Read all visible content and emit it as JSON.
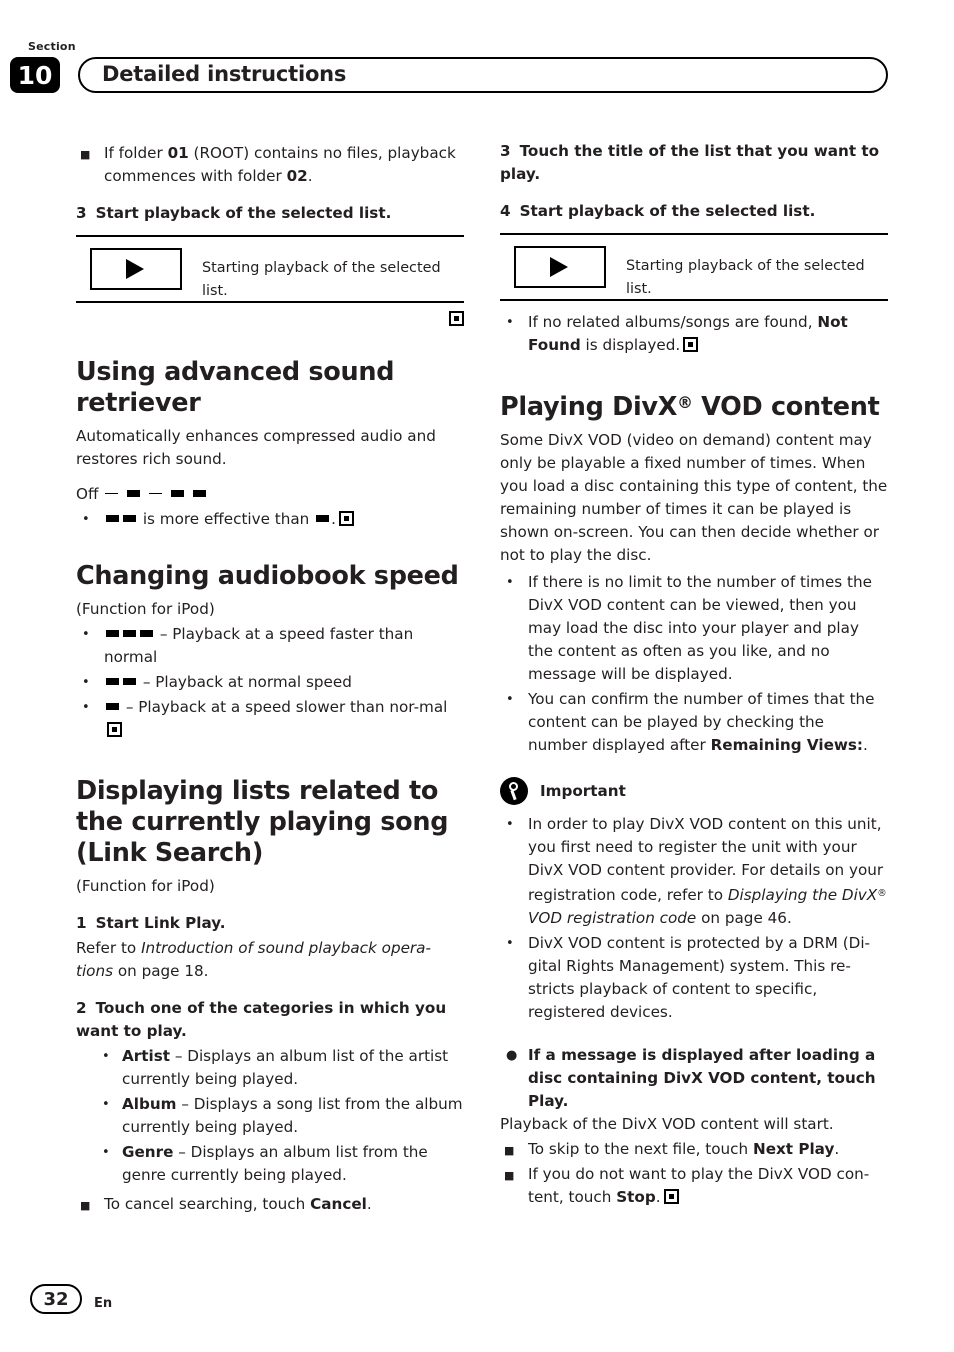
{
  "header": {
    "section_label": "Section",
    "section_number": "10",
    "title": "Detailed instructions"
  },
  "footer": {
    "page_number": "32",
    "language": "En"
  },
  "left_column": {
    "intro_bullet": "If folder 01 (ROOT) contains no files, playback commences with folder 02.",
    "step3_num": "3",
    "step3_text": "Start playback of the selected list.",
    "playbox_caption": "Starting playback of the selected list.",
    "heading_sound_retriever": "Using advanced sound retriever",
    "sound_retriever_body": "Automatically enhances compressed audio and restores rich sound.",
    "sound_retriever_off": "Off",
    "sound_retriever_bullet_tail": "is more effective than",
    "heading_audiobook": "Changing audiobook speed",
    "audiobook_function": "(Function for iPod)",
    "audiobook_fast": "– Playback at a speed faster than normal",
    "audiobook_normal": "– Playback at normal speed",
    "audiobook_slow": "– Playback at a speed slower than nor-mal",
    "heading_link_search": "Displaying lists related to the currently playing song (Link Search)",
    "link_search_function": "(Function for iPod)",
    "link_step1_num": "1",
    "link_step1_text": "Start Link Play.",
    "link_step1_refer_pre": "Refer to ",
    "link_step1_refer_italic": "Introduction of sound playback opera-tions",
    "link_step1_refer_post": " on page 18.",
    "link_step2_num": "2",
    "link_step2_text": "Touch one of the categories in which you want to play.",
    "cat_artist_label": "Artist",
    "cat_artist_text": "– Displays an album list of the artist currently being played.",
    "cat_album_label": "Album",
    "cat_album_text": "– Displays a song list from the album currently being played.",
    "cat_genre_label": "Genre",
    "cat_genre_text": "– Displays an album list from the genre currently being played.",
    "cancel_pre": "To cancel searching, touch ",
    "cancel_bold": "Cancel",
    "cancel_post": "."
  },
  "right_column": {
    "step3_num": "3",
    "step3_text": "Touch the title of the list that you want to play.",
    "step4_num": "4",
    "step4_text": "Start playback of the selected list.",
    "playbox_caption": "Starting playback of the selected list.",
    "not_found_pre": "If no related albums/songs are found, ",
    "not_found_bold": "Not Found",
    "not_found_post": " is displayed.",
    "heading_divx_pre": "Playing DivX",
    "heading_divx_sup": "®",
    "heading_divx_post": " VOD content",
    "divx_body": "Some DivX VOD (video on demand) content may only be playable a fixed number of times. When you load a disc containing this type of content, the remaining number of times it can be played is shown on-screen. You can then decide whether or not to play the disc.",
    "divx_bullet1": "If there is no limit to the number of times the DivX VOD content can be viewed, then you may load the disc into your player and play the content as often as you like, and no message will be displayed.",
    "divx_bullet2_pre": "You can confirm the number of times that the content can be played by checking the number displayed after ",
    "divx_bullet2_bold": "Remaining Views:",
    "divx_bullet2_post": ".",
    "important_title": "Important",
    "important_bullet1_pre": "In order to play DivX VOD content on this unit, you first need to register the unit with your DivX VOD content provider. For details on your registration code, refer to ",
    "important_bullet1_italic": "Displaying the DivX",
    "important_bullet1_sup": "®",
    "important_bullet1_italic2": "VOD registration code",
    "important_bullet1_post": " on page 46.",
    "important_bullet2": "DivX VOD content is protected by a DRM (Di-gital Rights Management) system. This re-stricts playback of content to specific, registered devices.",
    "message_bullet": "If a message is displayed after loading a disc containing DivX VOD content, touch Play.",
    "message_body": "Playback of the DivX VOD content will start.",
    "next_play_pre": "To skip to the next file, touch ",
    "next_play_bold": "Next Play",
    "next_play_post": ".",
    "stop_pre": "If you do not want to play the DivX VOD con-tent, touch ",
    "stop_bold": "Stop",
    "stop_post": "."
  },
  "icons": {
    "play": "play-triangle",
    "end_mark": "filled-square-end-mark",
    "important": "important-bell-icon"
  }
}
